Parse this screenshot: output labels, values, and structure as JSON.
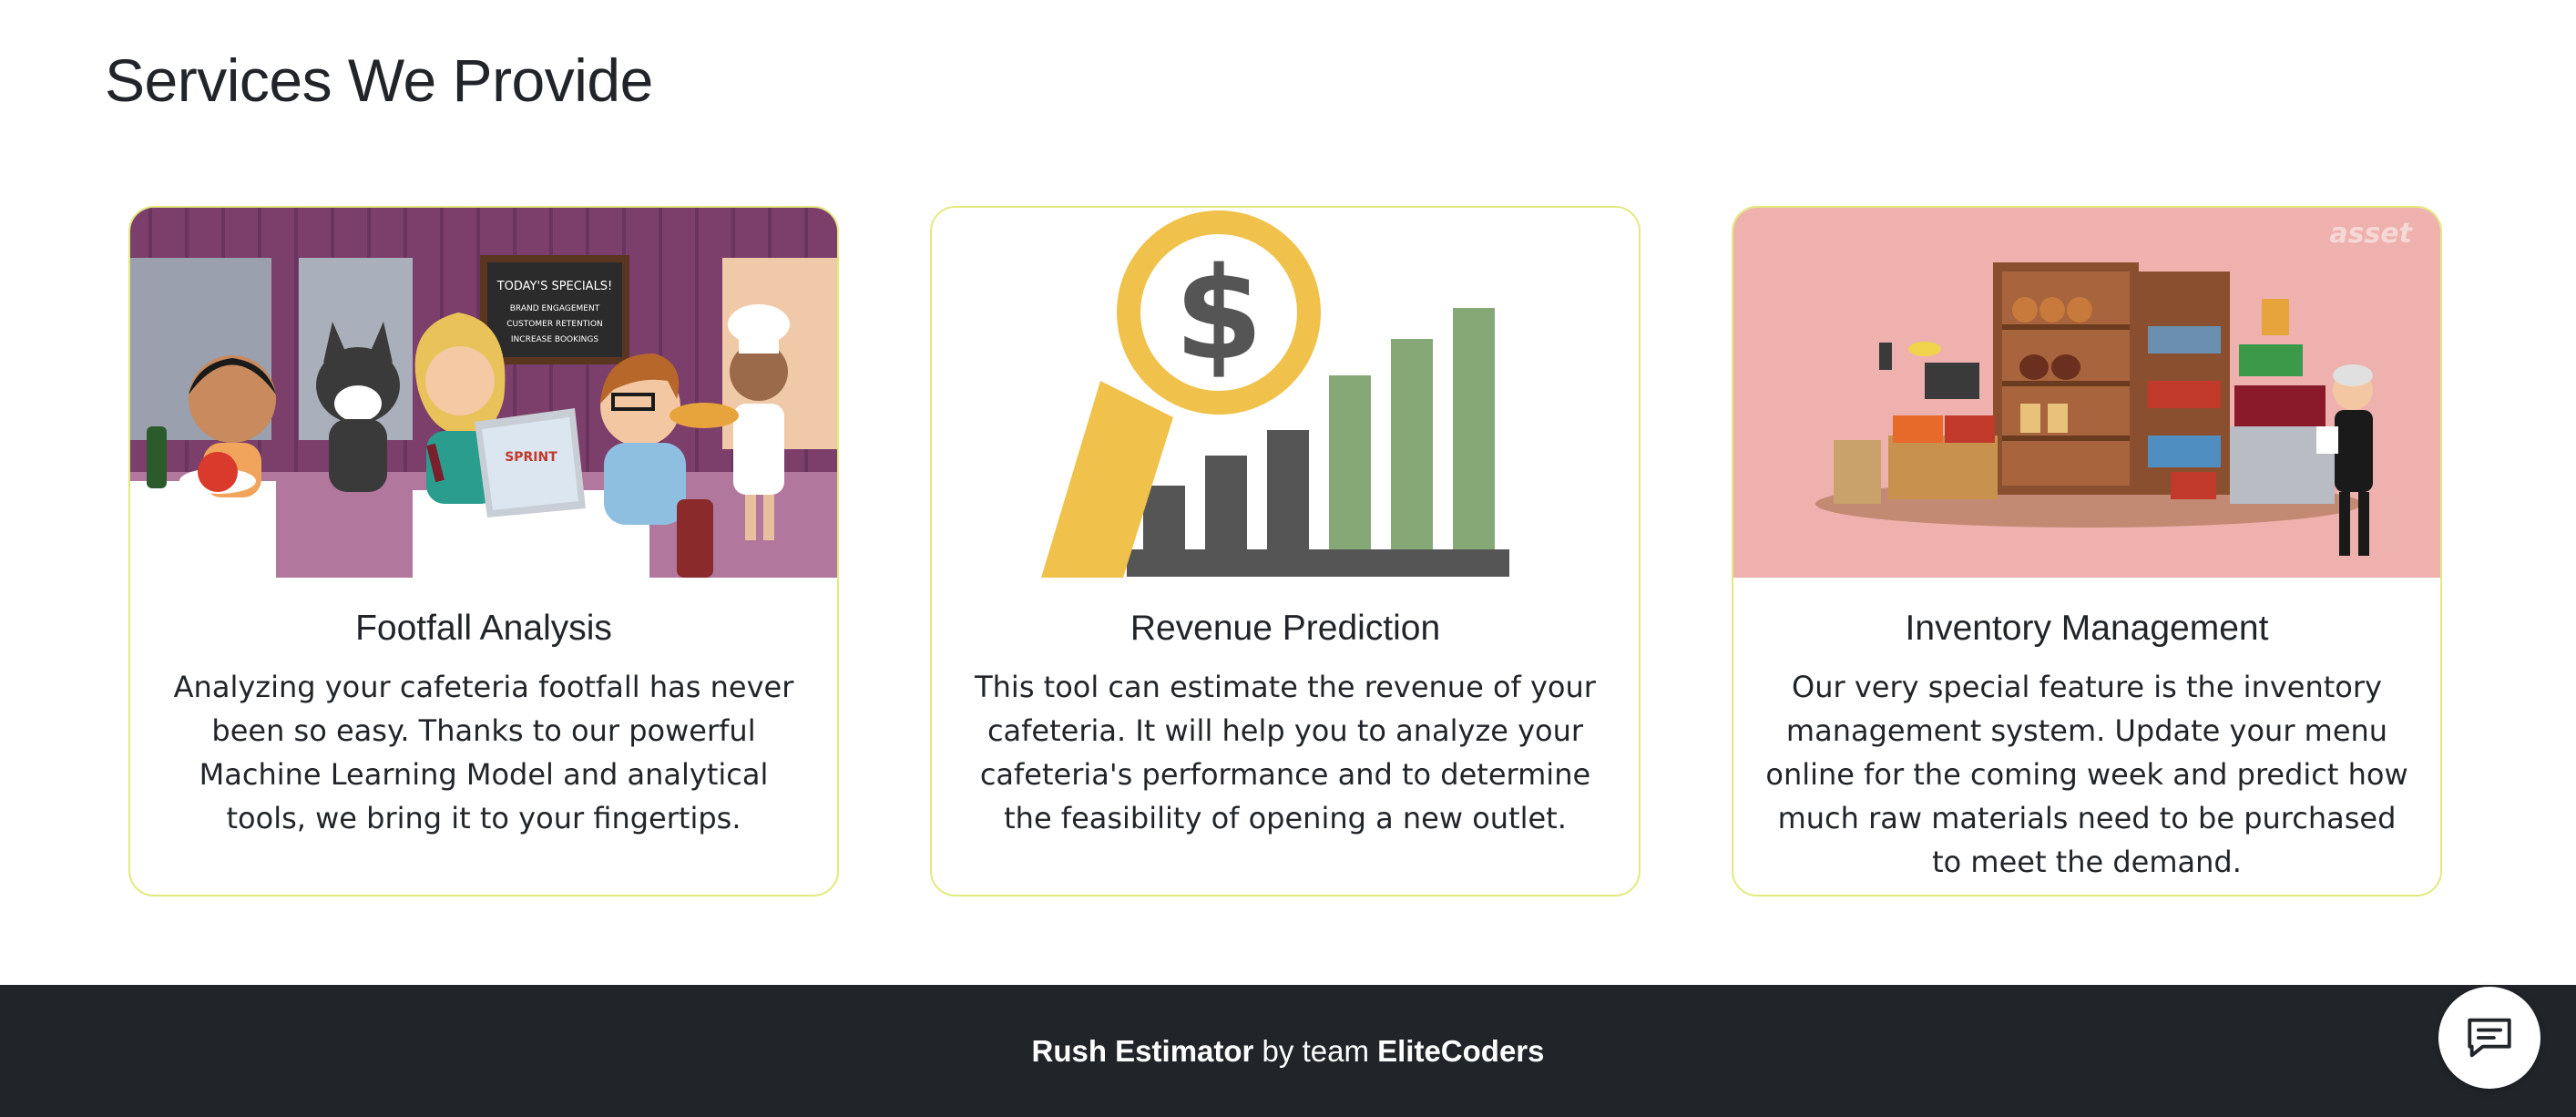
{
  "page": {
    "title": "Services We Provide"
  },
  "services": [
    {
      "title": "Footfall Analysis",
      "description": "Analyzing your cafeteria footfall has never been so easy. Thanks to our powerful Machine Learning Model and analytical tools, we bring it to your fingertips.",
      "image_icon": "cafeteria-illustration-icon",
      "board_title": "TODAY'S SPECIALS!",
      "board_lines": [
        "BRAND ENGAGEMENT",
        "CUSTOMER RETENTION",
        "INCREASE BOOKINGS"
      ],
      "laptop_text": "SPRINT"
    },
    {
      "title": "Revenue Prediction",
      "description": "This tool can estimate the revenue of your cafeteria. It will help you to analyze your cafeteria's performance and to determine the feasibility of opening a new outlet.",
      "image_icon": "revenue-chart-magnifier-icon",
      "currency_symbol": "$"
    },
    {
      "title": "Inventory Management",
      "description": "Our very special feature is the inventory management system. Update your menu online for the coming week and predict how much raw materials need to be purchased to meet the demand.",
      "image_icon": "grocery-store-illustration-icon",
      "watermark": "asset"
    }
  ],
  "footer": {
    "app_name": "Rush Estimator",
    "by_text": "by team",
    "team_name": "EliteCoders"
  },
  "chat_button": {
    "icon": "chat-icon"
  },
  "colors": {
    "card_border": "#e2ea7c",
    "footer_bg": "#212529",
    "accent_yellow": "#f0c24b",
    "bar_green": "#86a877",
    "bar_gray": "#555555",
    "card3_bg": "#eeb1ae",
    "card1_bg": "#7c3f6b"
  }
}
